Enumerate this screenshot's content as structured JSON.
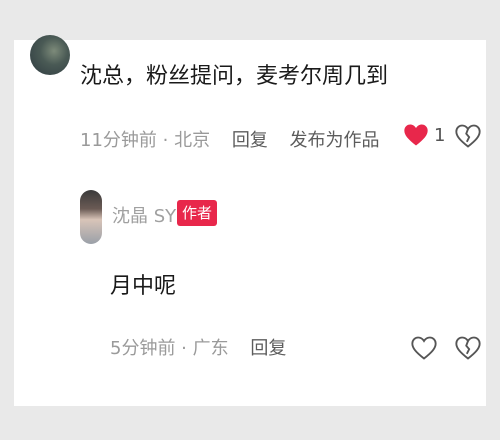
{
  "comments": [
    {
      "text": "沈总，粉丝提问，麦考尔周几到",
      "time_location": "11分钟前 · 北京",
      "reply_label": "回复",
      "publish_label": "发布为作品",
      "like_count": "1",
      "liked": true
    },
    {
      "username": "沈晶 SYD",
      "badge": "作者",
      "text": "月中呢",
      "time_location": "5分钟前 · 广东",
      "reply_label": "回复",
      "liked": false
    }
  ],
  "colors": {
    "like_active": "#e8274b",
    "badge": "#e8274b",
    "meta_text": "#9a9a9a"
  },
  "icons": [
    "heart-filled-icon",
    "heart-broken-icon",
    "heart-outline-icon"
  ]
}
